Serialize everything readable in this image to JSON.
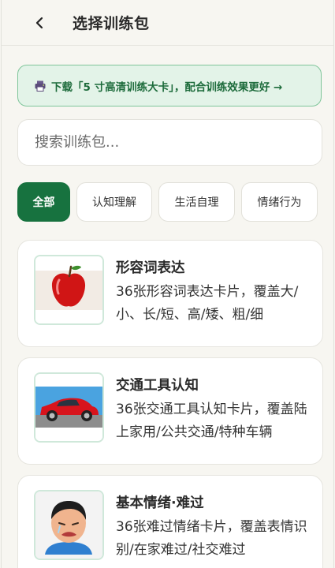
{
  "header": {
    "title": "选择训练包",
    "back_icon": "chevron-left-icon"
  },
  "banner": {
    "icon": "printer-icon",
    "text": "下载「5 寸高清训练大卡」，配合训练效果更好 →",
    "colors": {
      "border": "#7fc59a",
      "background": "#e3f3e8",
      "text": "#1d6b3b"
    }
  },
  "search": {
    "placeholder": "搜索训练包...",
    "value": ""
  },
  "tabs": [
    {
      "label": "全部",
      "active": true
    },
    {
      "label": "认知理解",
      "active": false
    },
    {
      "label": "生活自理",
      "active": false
    },
    {
      "label": "情绪行为",
      "active": false
    }
  ],
  "packs": [
    {
      "title": "形容词表达",
      "desc": "36张形容词表达卡片，覆盖大/小、长/短、高/矮、粗/细",
      "image": "apple"
    },
    {
      "title": "交通工具认知",
      "desc": "36张交通工具认知卡片，覆盖陆上家用/公共交通/特种车辆",
      "image": "red-car"
    },
    {
      "title": "基本情绪·难过",
      "desc": "36张难过情绪卡片，覆盖表情识别/在家难过/社交难过",
      "image": "crying-child"
    }
  ],
  "colors": {
    "accent": "#17723f",
    "background": "#f7f6f1"
  }
}
